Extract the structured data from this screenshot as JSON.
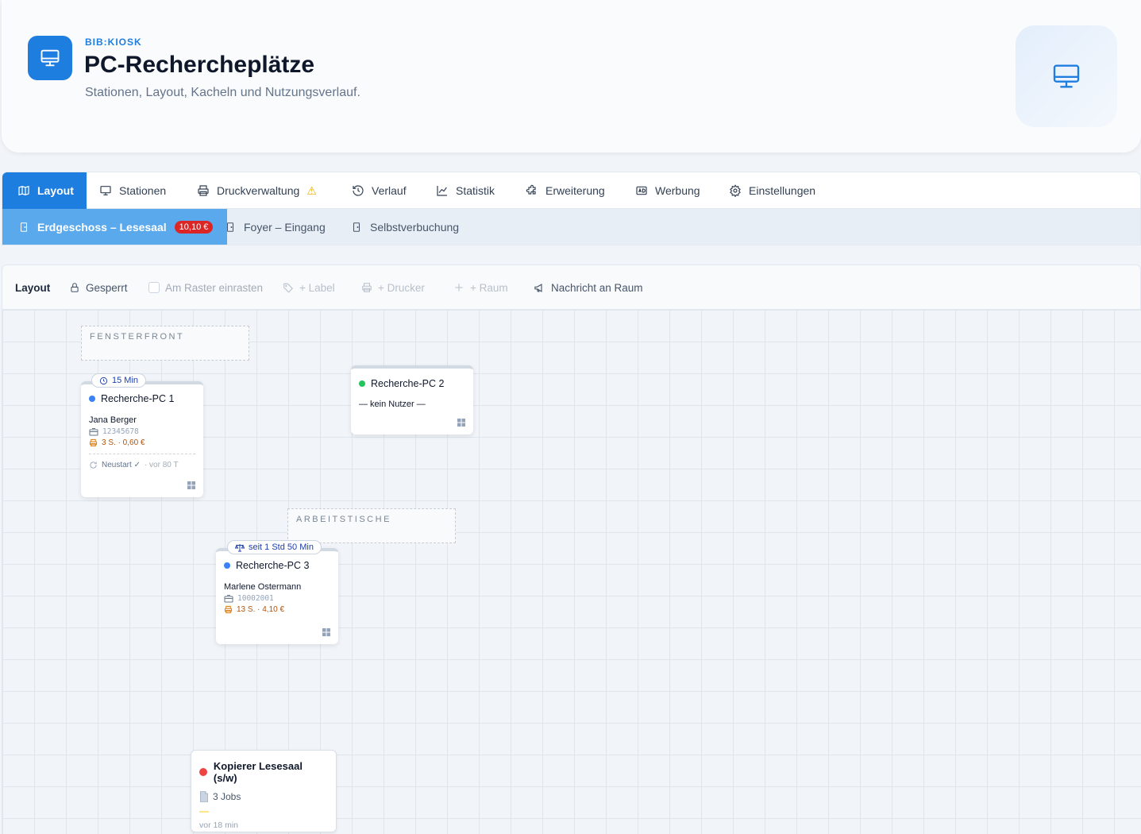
{
  "header": {
    "kicker": "BIB:KIOSK",
    "title": "PC-Rechercheplätze",
    "subtitle": "Stationen, Layout, Kacheln und Nutzungsverlauf."
  },
  "tabs": [
    {
      "label": "Layout",
      "icon": "map-icon",
      "active": true
    },
    {
      "label": "Stationen",
      "icon": "monitor-icon"
    },
    {
      "label": "Druckverwaltung",
      "icon": "printer-icon",
      "warning": "⚠"
    },
    {
      "label": "Verlauf",
      "icon": "history-icon"
    },
    {
      "label": "Statistik",
      "icon": "chart-icon"
    },
    {
      "label": "Erweiterung",
      "icon": "puzzle-icon"
    },
    {
      "label": "Werbung",
      "icon": "ad-icon"
    },
    {
      "label": "Einstellungen",
      "icon": "gear-icon"
    }
  ],
  "rooms": [
    {
      "label": "Erdgeschoss – Lesesaal",
      "badge": "10,10 €",
      "active": true
    },
    {
      "label": "Foyer – Eingang"
    },
    {
      "label": "Selbstverbuchung"
    }
  ],
  "toolbar": {
    "title": "Layout",
    "locked": "Gesperrt",
    "snap": "Am Raster einrasten",
    "add_label": "+ Label",
    "add_printer": "+ Drucker",
    "add_room": "+ Raum",
    "message": "Nachricht an Raum"
  },
  "zones": [
    {
      "label": "FENSTERFRONT"
    },
    {
      "label": "ARBEITSTISCHE"
    }
  ],
  "stations": [
    {
      "name": "Recherche-PC 1",
      "status_color": "#3b82f6",
      "pill": "15 Min",
      "user": "Jana Berger",
      "card_id": "12345678",
      "print": "3 S. · 0,60 €",
      "restart": "Neustart ✓",
      "restart_age": "· vor 80 T"
    },
    {
      "name": "Recherche-PC 2",
      "status_color": "#22c55e",
      "empty": "— kein Nutzer —"
    },
    {
      "name": "Recherche-PC 3",
      "status_color": "#3b82f6",
      "pill": "seit 1 Std 50 Min",
      "user": "Marlene Ostermann",
      "card_id": "10002001",
      "print": "13 S. · 4,10 €"
    }
  ],
  "printer": {
    "name": "Kopierer Lesesaal (s/w)",
    "status_color": "#ef4444",
    "jobs": "3 Jobs",
    "age": "vor 18 min"
  },
  "colors": {
    "accent": "#1d7ee0",
    "subtab_active": "#5aa9ec",
    "badge": "#dc2626"
  }
}
